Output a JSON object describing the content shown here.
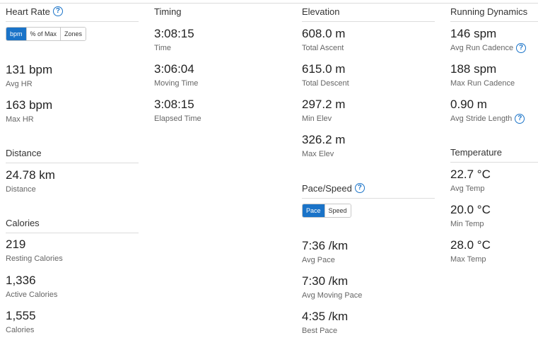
{
  "heart_rate": {
    "title": "Heart Rate",
    "toggle": [
      "bpm",
      "% of Max",
      "Zones"
    ],
    "active_toggle": "bpm",
    "stats": [
      {
        "value": "131 bpm",
        "label": "Avg HR"
      },
      {
        "value": "163 bpm",
        "label": "Max HR"
      }
    ]
  },
  "distance": {
    "title": "Distance",
    "stats": [
      {
        "value": "24.78 km",
        "label": "Distance"
      }
    ]
  },
  "calories": {
    "title": "Calories",
    "stats": [
      {
        "value": "219",
        "label": "Resting Calories"
      },
      {
        "value": "1,336",
        "label": "Active Calories"
      },
      {
        "value": "1,555",
        "label": "Calories"
      }
    ]
  },
  "timing": {
    "title": "Timing",
    "stats": [
      {
        "value": "3:08:15",
        "label": "Time"
      },
      {
        "value": "3:06:04",
        "label": "Moving Time"
      },
      {
        "value": "3:08:15",
        "label": "Elapsed Time"
      }
    ]
  },
  "elevation": {
    "title": "Elevation",
    "stats": [
      {
        "value": "608.0 m",
        "label": "Total Ascent"
      },
      {
        "value": "615.0 m",
        "label": "Total Descent"
      },
      {
        "value": "297.2 m",
        "label": "Min Elev"
      },
      {
        "value": "326.2 m",
        "label": "Max Elev"
      }
    ]
  },
  "pace_speed": {
    "title": "Pace/Speed",
    "toggle": [
      "Pace",
      "Speed"
    ],
    "active_toggle": "Pace",
    "stats": [
      {
        "value": "7:36 /km",
        "label": "Avg Pace"
      },
      {
        "value": "7:30 /km",
        "label": "Avg Moving Pace"
      },
      {
        "value": "4:35 /km",
        "label": "Best Pace"
      }
    ]
  },
  "running_dynamics": {
    "title": "Running Dynamics",
    "stats": [
      {
        "value": "146 spm",
        "label": "Avg Run Cadence"
      },
      {
        "value": "188 spm",
        "label": "Max Run Cadence"
      },
      {
        "value": "0.90 m",
        "label": "Avg Stride Length"
      }
    ]
  },
  "temperature": {
    "title": "Temperature",
    "stats": [
      {
        "value": "22.7 °C",
        "label": "Avg Temp"
      },
      {
        "value": "20.0 °C",
        "label": "Min Temp"
      },
      {
        "value": "28.0 °C",
        "label": "Max Temp"
      }
    ]
  },
  "help_icon_glyph": "?",
  "accent_color": "#1a73c8"
}
